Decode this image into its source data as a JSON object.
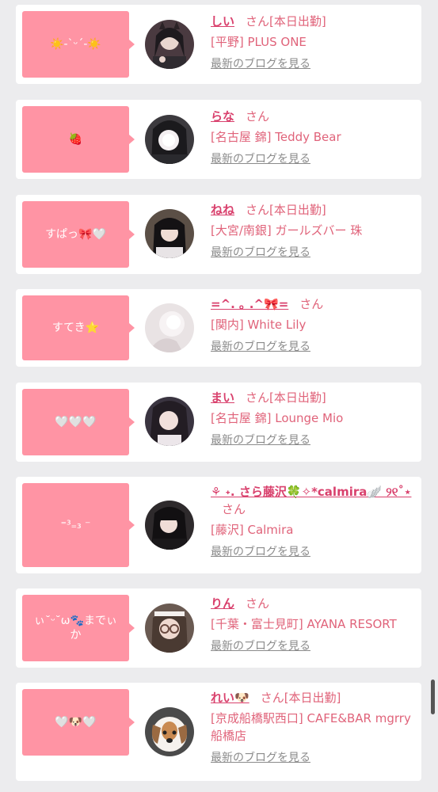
{
  "cards": [
    {
      "bubble": "☀️-`ᵕ´-☀️",
      "name": "しい",
      "san": "さん",
      "status": "[本日出勤]",
      "shop": "[平野] PLUS ONE",
      "blog": "最新のブログを見る"
    },
    {
      "bubble": "🍓",
      "name": "らな",
      "san": "さん",
      "status": "",
      "shop": "[名古屋 錦] Teddy Bear",
      "blog": "最新のブログを見る"
    },
    {
      "bubble": "すぱっ🎀🤍",
      "name": "ねね",
      "san": "さん",
      "status": "[本日出勤]",
      "shop": "[大宮/南銀] ガールズバー 珠",
      "blog": "最新のブログを見る"
    },
    {
      "bubble": "すてき⭐",
      "name": "=^. ｡ .^🎀=",
      "san": "さん",
      "status": "",
      "shop": "[関内] White Lily",
      "blog": "最新のブログを見る"
    },
    {
      "bubble": "🤍🤍🤍",
      "name": "まい",
      "san": "さん",
      "status": "[本日出勤]",
      "shop": "[名古屋 錦] Lounge Mio",
      "blog": "最新のブログを見る"
    },
    {
      "bubble": "⁼³₌₃ ⁻",
      "name": "⚘ ˖. さら藤沢🍀✧*calmira🪽 ୨୧˚⋆",
      "san": "さん",
      "status": "",
      "shop": "[藤沢] Calmira",
      "blog": "最新のブログを見る"
    },
    {
      "bubble": "ぃ˘ᵕ˘ω🐾までぃか",
      "name": "りん",
      "san": "さん",
      "status": "",
      "shop": "[千葉・富士見町] AYANA RESORT",
      "blog": "最新のブログを見る"
    },
    {
      "bubble": "🤍🐶🤍",
      "name": "れい🐶",
      "san": "さん",
      "status": "[本日出勤]",
      "shop": "[京成船橋駅西口] CAFE&BAR mgrry 船橋店",
      "blog": "最新のブログを見る"
    }
  ]
}
